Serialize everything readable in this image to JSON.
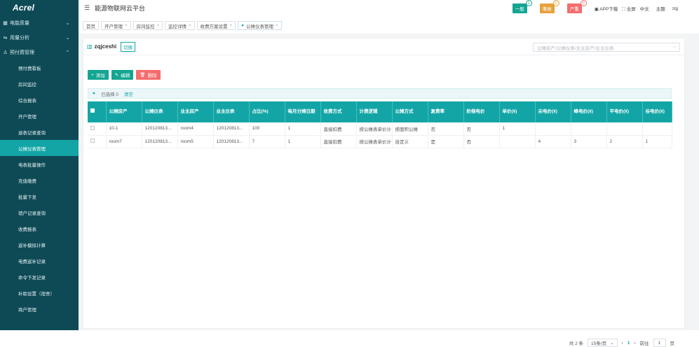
{
  "brand": {
    "logo": "Acrel",
    "app_title": "能源物联网云平台"
  },
  "header": {
    "badges": [
      {
        "label": "一般",
        "count": "1",
        "color": "#13a592"
      },
      {
        "label": "事故",
        "count": "0",
        "color": "#e6a23c"
      },
      {
        "label": "严重",
        "count": "0",
        "color": "#f56c6c"
      }
    ],
    "app_download": "APP下载",
    "fullscreen": "全屏",
    "language": "中文",
    "theme": "主题",
    "user": "zqj"
  },
  "sidebar": {
    "groups": [
      {
        "label": "电能质量"
      },
      {
        "label": "用量分析"
      },
      {
        "label": "预付费管理"
      }
    ],
    "items": [
      {
        "label": "预付费看板"
      },
      {
        "label": "房间监控"
      },
      {
        "label": "综合报表"
      },
      {
        "label": "开户管理"
      },
      {
        "label": "退表记录查询"
      },
      {
        "label": "公摊仪表管理"
      },
      {
        "label": "电表批量操作"
      },
      {
        "label": "充值缴费"
      },
      {
        "label": "批量下发"
      },
      {
        "label": "销户记录查询"
      },
      {
        "label": "收费报表"
      },
      {
        "label": "返补模拟计算"
      },
      {
        "label": "电费返补记录"
      },
      {
        "label": "命令下发记录"
      },
      {
        "label": "补助设置（宿舍）"
      },
      {
        "label": "商户管理"
      }
    ]
  },
  "tabs": [
    {
      "label": "首页"
    },
    {
      "label": "开户管理"
    },
    {
      "label": "房间监控"
    },
    {
      "label": "监控详情"
    },
    {
      "label": "收费方案设置"
    },
    {
      "label": "公摊仪表管理"
    }
  ],
  "panel": {
    "project": "zqjceshi",
    "switch_label": "切换",
    "search_placeholder": "公摊房产/公摊仪表/业主房产/业主仪表",
    "add_label": "添加",
    "edit_label": "编辑",
    "delete_label": "删除",
    "selected_text": "已选择 0",
    "clear_label": "清空"
  },
  "table": {
    "headers": [
      "公摊房产",
      "公摊仪表",
      "业主房产",
      "业主仪表",
      "占比(%)",
      "每月分摊日期",
      "收费方式",
      "计费逻辑",
      "公摊方式",
      "复费率",
      "阶梯电价",
      "单价(¥)",
      "尖电价(¥)",
      "峰电价(¥)",
      "平电价(¥)",
      "谷电价(¥)"
    ],
    "rows": [
      [
        "10-1",
        "120120813...",
        "room4",
        "120120813...",
        "100",
        "1",
        "直接扣费",
        "按公摊表单价计",
        "按面积公摊",
        "否",
        "否",
        "1",
        "",
        "",
        "",
        ""
      ],
      [
        "room7",
        "120120813...",
        "room5",
        "120120813...",
        "7",
        "1",
        "直接扣费",
        "按公摊表单价计",
        "自定义",
        "是",
        "否",
        "",
        "4",
        "3",
        "2",
        "1"
      ]
    ]
  },
  "pager": {
    "total": "共 2 条",
    "page_size": "15条/页",
    "current": "1",
    "goto_label": "前往",
    "goto_value": "1",
    "page_unit": "页"
  }
}
